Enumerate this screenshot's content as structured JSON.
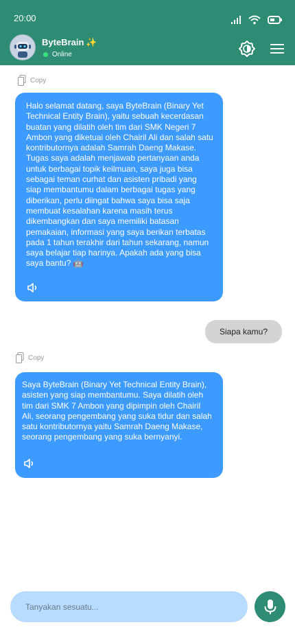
{
  "status_bar": {
    "time": "20:00"
  },
  "header": {
    "title": "ByteBrain",
    "sparkle": "✨",
    "status": "Online",
    "colors": {
      "bar": "#2e8b74",
      "online_dot": "#39e07a"
    }
  },
  "messages": [
    {
      "role": "bot",
      "copy_label": "Copy",
      "text": "Halo selamat datang, saya ByteBrain (Binary Yet Technical Entity Brain), yaitu sebuah kecerdasan buatan yang dilatih oleh tim dari SMK Negeri 7 Ambon yang diketuai oleh Chairil Ali dan salah satu kontributornya adalah Samrah Daeng Makase. Tugas saya adalah menjawab pertanyaan anda untuk berbagai topik keilmuan, saya juga bisa sebagai teman curhat dan asisten pribadi yang siap membantumu dalam berbagai tugas yang diberikan, perlu diingat bahwa saya bisa saja membuat kesalahan karena masih terus dikembangkan dan saya memiliki batasan pemakaian, informasi yang saya berikan terbatas pada 1 tahun terakhir dari tahun sekarang, namun saya belajar tiap harinya. Apakah ada yang bisa saya bantu? 🤖"
    },
    {
      "role": "user",
      "text": "Siapa kamu?"
    },
    {
      "role": "bot",
      "copy_label": "Copy",
      "text": "Saya ByteBrain (Binary Yet Technical Entity Brain), asisten yang siap membantumu. Saya dilatih oleh tim dari SMK 7 Ambon yang dipimpin oleh Chairil Ali, seorang pengembang yang suka tidur dan salah satu kontributornya yaitu Samrah Daeng Makase, seorang pengembang yang suka bernyanyi."
    }
  ],
  "composer": {
    "placeholder": "Tanyakan sesuatu...",
    "colors": {
      "input_bg": "#b7dcff",
      "mic_bg": "#2e8b74"
    }
  },
  "colors": {
    "bot_bubble": "#3d9bff",
    "user_bubble": "#d4d4d4"
  },
  "icons": [
    "signal-icon",
    "wifi-icon",
    "battery-icon",
    "theme-toggle-icon",
    "menu-icon",
    "copy-icon",
    "speaker-icon",
    "mic-icon",
    "robot-avatar"
  ]
}
